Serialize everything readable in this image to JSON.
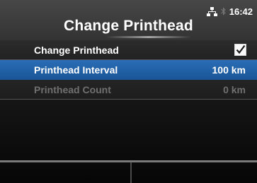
{
  "header": {
    "title": "Change Printhead",
    "time": "16:42",
    "icons": [
      "network-icon",
      "bluetooth-icon"
    ]
  },
  "menu": {
    "items": [
      {
        "label": "Change Printhead",
        "value": "",
        "control": "checkbox",
        "checked": true,
        "state": "normal"
      },
      {
        "label": "Printhead Interval",
        "value": "100 km",
        "state": "selected"
      },
      {
        "label": "Printhead Count",
        "value": "0 km",
        "state": "disabled"
      }
    ]
  },
  "colors": {
    "selected_row": "#2266b0",
    "disabled_text": "#707070",
    "header_bg": "#3c3c3c"
  },
  "softkeys": {
    "left_label": "",
    "right_label": ""
  }
}
